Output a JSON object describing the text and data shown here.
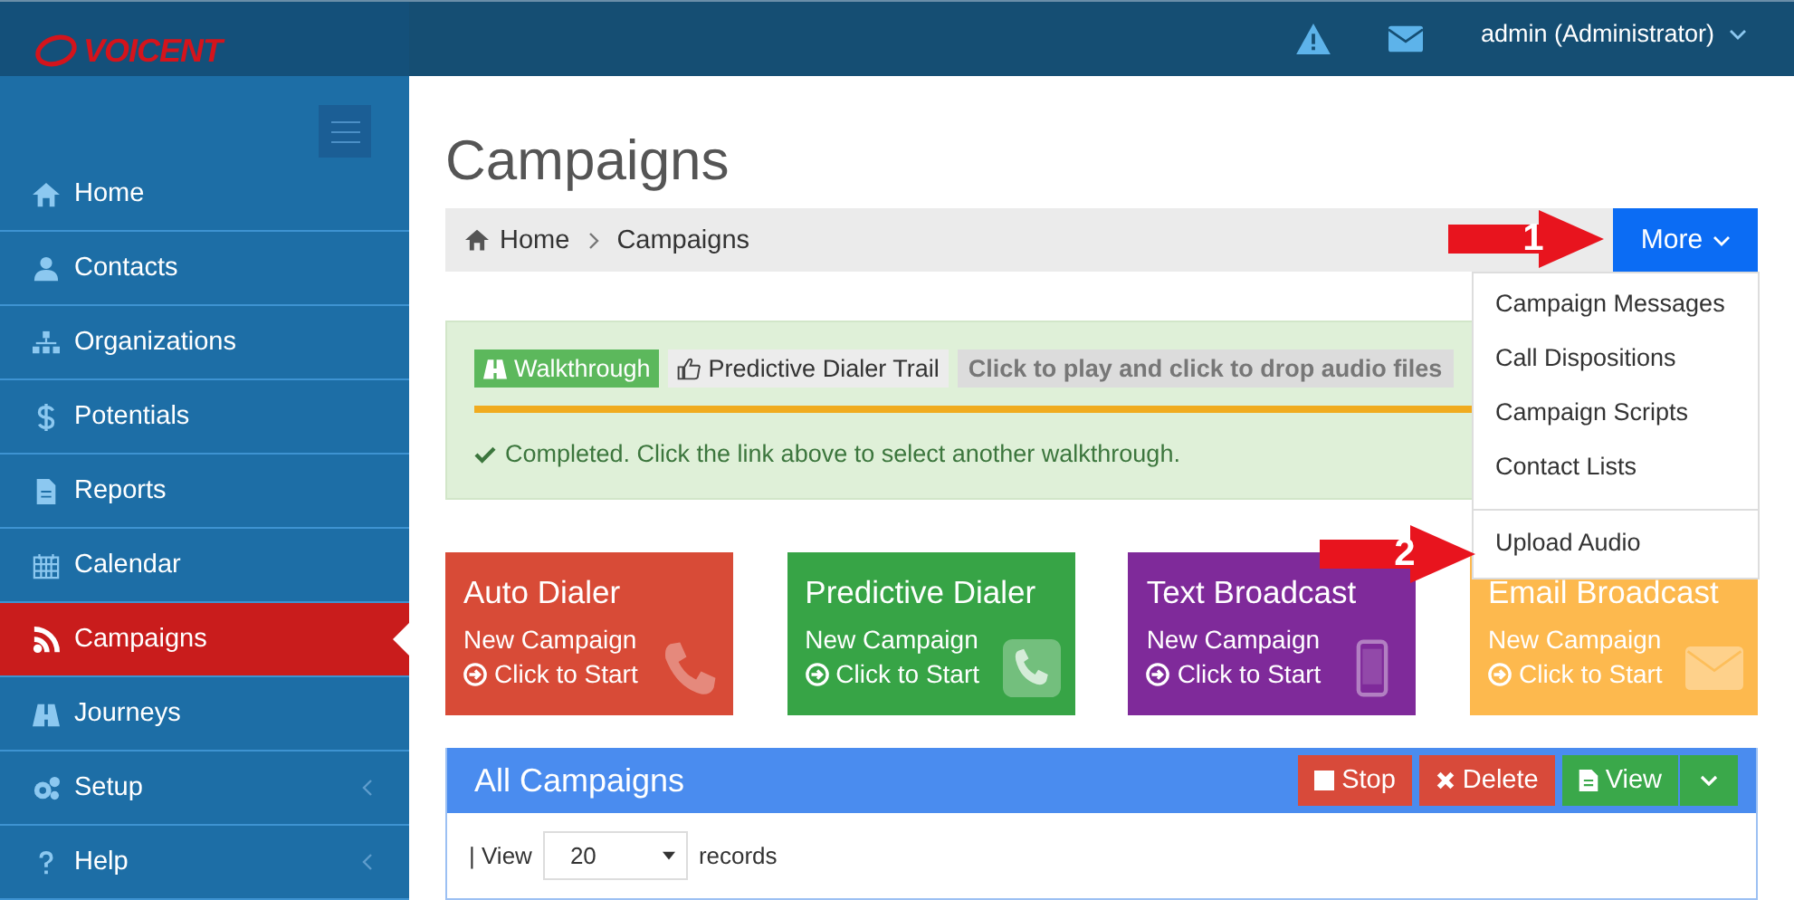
{
  "header": {
    "logo": "VOICENT",
    "user": "admin (Administrator)"
  },
  "sidebar": {
    "items": [
      {
        "label": "Home",
        "selected": false,
        "expandable": false
      },
      {
        "label": "Contacts",
        "selected": false,
        "expandable": false
      },
      {
        "label": "Organizations",
        "selected": false,
        "expandable": false
      },
      {
        "label": "Potentials",
        "selected": false,
        "expandable": false
      },
      {
        "label": "Reports",
        "selected": false,
        "expandable": false
      },
      {
        "label": "Calendar",
        "selected": false,
        "expandable": false
      },
      {
        "label": "Campaigns",
        "selected": true,
        "expandable": false
      },
      {
        "label": "Journeys",
        "selected": false,
        "expandable": false
      },
      {
        "label": "Setup",
        "selected": false,
        "expandable": true
      },
      {
        "label": "Help",
        "selected": false,
        "expandable": true
      }
    ]
  },
  "page": {
    "title": "Campaigns",
    "breadcrumb": [
      "Home",
      "Campaigns"
    ],
    "more_button": "More"
  },
  "more_menu": {
    "groups": [
      [
        "Campaign Messages",
        "Call Dispositions",
        "Campaign Scripts",
        "Contact Lists"
      ],
      [
        "Upload Audio"
      ]
    ]
  },
  "walkthrough": {
    "badge": "Walkthrough",
    "trail": "Predictive Dialer Trail",
    "hint": "Click to play and click to drop audio files",
    "level": 1,
    "status": "Completed. Click the link above to select another walkthrough."
  },
  "cards": [
    {
      "kind": "auto",
      "title": "Auto Dialer",
      "line": "New Campaign",
      "action": "Click to Start",
      "color": "#d84b37"
    },
    {
      "kind": "predictive",
      "title": "Predictive Dialer",
      "line": "New Campaign",
      "action": "Click to Start",
      "color": "#37a446"
    },
    {
      "kind": "text",
      "title": "Text Broadcast",
      "line": "New Campaign",
      "action": "Click to Start",
      "color": "#7f2a9a"
    },
    {
      "kind": "email",
      "title": "Email Broadcast",
      "line": "New Campaign",
      "action": "Click to Start",
      "color": "#fdb94e"
    }
  ],
  "panel": {
    "title": "All Campaigns",
    "buttons": [
      {
        "kind": "stop",
        "label": "Stop"
      },
      {
        "kind": "delete",
        "label": "Delete"
      },
      {
        "kind": "view",
        "label": "View"
      }
    ],
    "view_label": "| View",
    "page_size": "20",
    "records_label": "records"
  },
  "annotations": [
    {
      "label": "1"
    },
    {
      "label": "2"
    }
  ]
}
